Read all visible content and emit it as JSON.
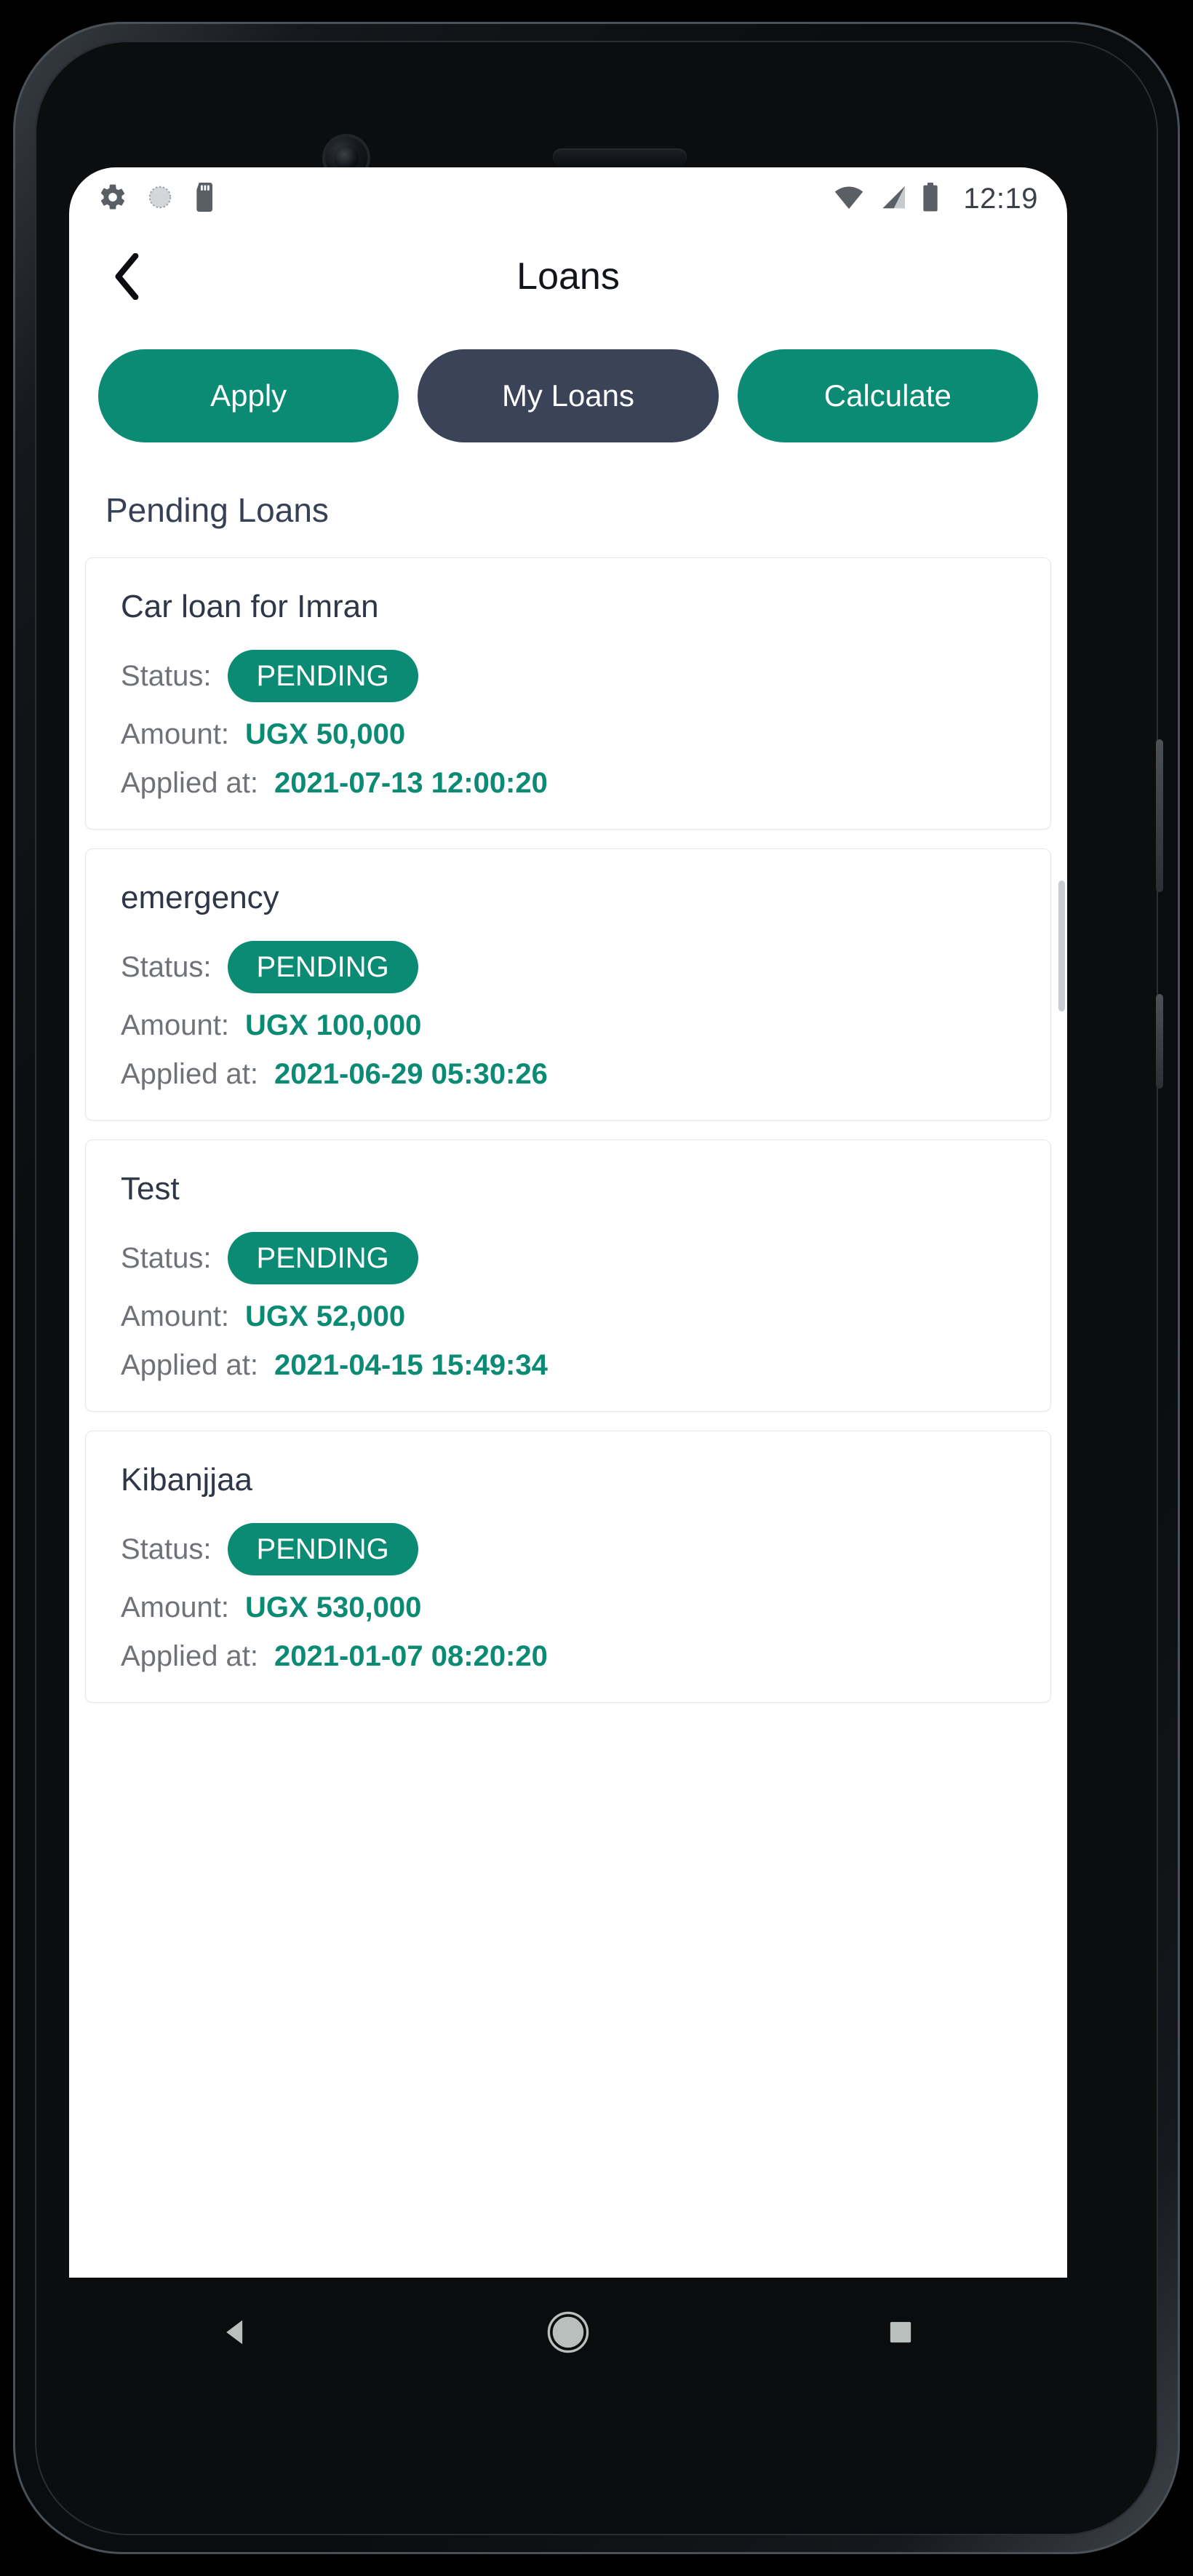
{
  "status_bar": {
    "time": "12:19",
    "left_icons": [
      "settings-gear-icon",
      "circle-dotted-icon",
      "sd-card-icon"
    ],
    "right_icons": [
      "wifi-icon",
      "cellular-signal-icon",
      "battery-icon"
    ]
  },
  "app_bar": {
    "back_icon": "chevron-left-icon",
    "title": "Loans"
  },
  "actions": [
    {
      "label": "Apply",
      "style": "primary"
    },
    {
      "label": "My Loans",
      "style": "dark"
    },
    {
      "label": "Calculate",
      "style": "primary"
    }
  ],
  "section": {
    "heading": "Pending Loans"
  },
  "labels": {
    "status": "Status:",
    "amount": "Amount:",
    "applied_at": "Applied at:"
  },
  "loans": [
    {
      "title": "Car loan for Imran",
      "status": "PENDING",
      "amount": "UGX 50,000",
      "applied_at": "2021-07-13 12:00:20"
    },
    {
      "title": "emergency",
      "status": "PENDING",
      "amount": "UGX 100,000",
      "applied_at": "2021-06-29 05:30:26"
    },
    {
      "title": "Test",
      "status": "PENDING",
      "amount": "UGX 52,000",
      "applied_at": "2021-04-15 15:49:34"
    },
    {
      "title": "Kibanjjaa",
      "status": "PENDING",
      "amount": "UGX 530,000",
      "applied_at": "2021-01-07 08:20:20"
    }
  ],
  "nav_bar": {
    "back": "nav-back-triangle-icon",
    "home": "nav-home-circle-icon",
    "recents": "nav-recents-square-icon"
  },
  "colors": {
    "accent_teal": "#0b8a74",
    "dark_navy": "#3b4358",
    "heading": "#374055",
    "muted_label": "#6f7378"
  }
}
